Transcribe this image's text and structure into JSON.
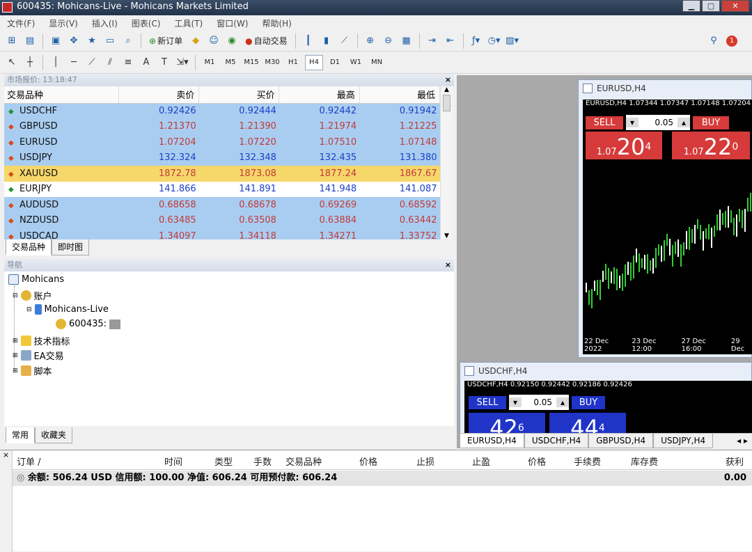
{
  "window": {
    "title": "600435: Mohicans-Live - Mohicans Markets Limited"
  },
  "menu": [
    "文件(F)",
    "显示(V)",
    "插入(I)",
    "图表(C)",
    "工具(T)",
    "窗口(W)",
    "帮助(H)"
  ],
  "toolbar": {
    "new_order": "新订单",
    "auto_trade": "自动交易",
    "notif_count": "1"
  },
  "toolbar2": {
    "timeframes": [
      "M1",
      "M5",
      "M15",
      "M30",
      "H1",
      "H4",
      "D1",
      "W1",
      "MN"
    ],
    "active": "H4",
    "text_tool": "A"
  },
  "market_watch": {
    "header": "市场报价: 13:18:47",
    "columns": [
      "交易品种",
      "卖价",
      "买价",
      "最高",
      "最低"
    ],
    "rows": [
      {
        "symbol": "USDCHF",
        "dir": "up",
        "bid": "0.92426",
        "ask": "0.92444",
        "high": "0.92442",
        "low": "0.91942",
        "style": "blue",
        "price_color": "blue"
      },
      {
        "symbol": "GBPUSD",
        "dir": "down",
        "bid": "1.21370",
        "ask": "1.21390",
        "high": "1.21974",
        "low": "1.21225",
        "style": "blue",
        "price_color": "red"
      },
      {
        "symbol": "EURUSD",
        "dir": "down",
        "bid": "1.07204",
        "ask": "1.07220",
        "high": "1.07510",
        "low": "1.07148",
        "style": "blue",
        "price_color": "red"
      },
      {
        "symbol": "USDJPY",
        "dir": "down",
        "bid": "132.324",
        "ask": "132.348",
        "high": "132.435",
        "low": "131.380",
        "style": "blue",
        "price_color": "blue"
      },
      {
        "symbol": "XAUUSD",
        "dir": "down",
        "bid": "1872.78",
        "ask": "1873.08",
        "high": "1877.24",
        "low": "1867.67",
        "style": "gold",
        "price_color": "red"
      },
      {
        "symbol": "EURJPY",
        "dir": "up",
        "bid": "141.866",
        "ask": "141.891",
        "high": "141.948",
        "low": "141.087",
        "style": "white",
        "price_color": "blue"
      },
      {
        "symbol": "AUDUSD",
        "dir": "down",
        "bid": "0.68658",
        "ask": "0.68678",
        "high": "0.69269",
        "low": "0.68592",
        "style": "blue",
        "price_color": "red"
      },
      {
        "symbol": "NZDUSD",
        "dir": "down",
        "bid": "0.63485",
        "ask": "0.63508",
        "high": "0.63884",
        "low": "0.63442",
        "style": "blue",
        "price_color": "red"
      },
      {
        "symbol": "USDCAD",
        "dir": "down",
        "bid": "1.34097",
        "ask": "1.34118",
        "high": "1.34271",
        "low": "1.33752",
        "style": "blue",
        "price_color": "red"
      }
    ],
    "tabs": [
      "交易品种",
      "即时图"
    ]
  },
  "navigator": {
    "header": "导航",
    "root": "Mohicans",
    "accounts": "账户",
    "server": "Mohicans-Live",
    "account": "600435: ",
    "indicators": "技术指标",
    "ea": "EA交易",
    "scripts": "脚本",
    "tabs": [
      "常用",
      "收藏夹"
    ]
  },
  "charts": [
    {
      "title": "EURUSD,H4",
      "ohlc": "EURUSD,H4  1.07344 1.07347 1.07148 1.07204",
      "sell": "SELL",
      "buy": "BUY",
      "lot": "0.05",
      "sell_pre": "1.07",
      "sell_big": "20",
      "sell_sup": "4",
      "buy_pre": "1.07",
      "buy_big": "22",
      "buy_sup": "0",
      "dates": [
        "22 Dec 2022",
        "23 Dec 12:00",
        "27 Dec 16:00",
        "29 Dec"
      ]
    },
    {
      "title": "USDCHF,H4",
      "ohlc": "USDCHF,H4  0.92150 0.92442 0.92186 0.92426",
      "sell": "SELL",
      "buy": "BUY",
      "lot": "0.05",
      "sell_big": "42",
      "sell_sup": "6",
      "buy_big": "44",
      "buy_sup": "4"
    }
  ],
  "chart_tabs": [
    "EURUSD,H4",
    "USDCHF,H4",
    "GBPUSD,H4",
    "USDJPY,H4"
  ],
  "terminal": {
    "columns": [
      "订单 /",
      "时间",
      "类型",
      "手数",
      "交易品种",
      "价格",
      "止损",
      "止盈",
      "价格",
      "手续费",
      "库存费",
      "获利"
    ],
    "balance_line": "余额: 506.24 USD  信用额: 100.00  净值: 606.24  可用预付款: 606.24",
    "balance_profit": "0.00"
  }
}
